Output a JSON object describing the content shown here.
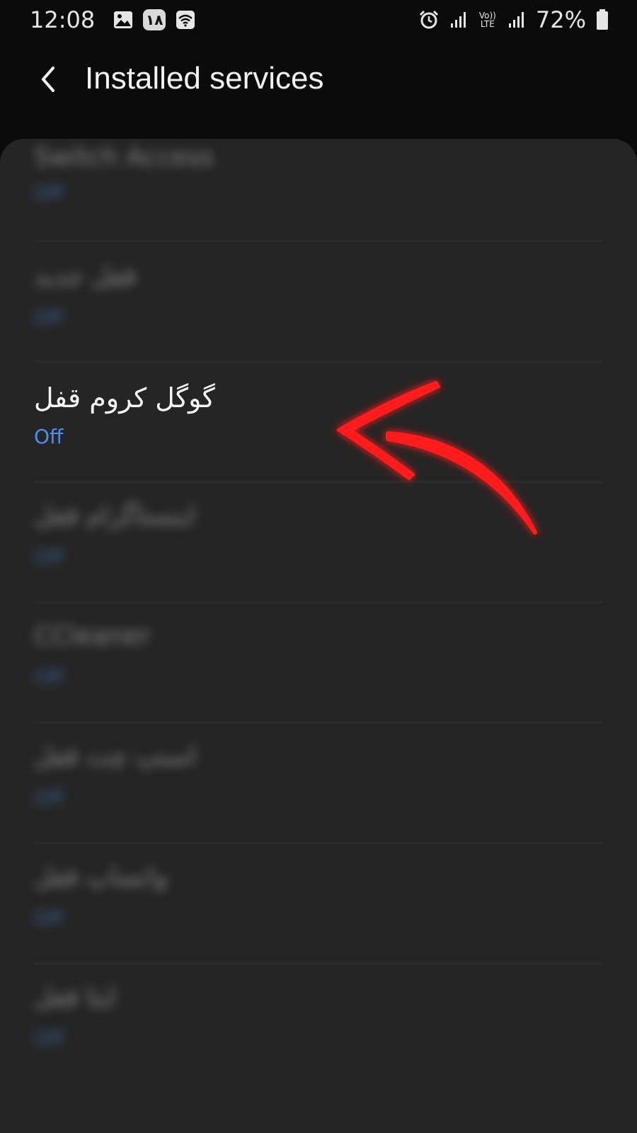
{
  "status_bar": {
    "time": "12:08",
    "badge": "١٨",
    "volte_top": "Vo))",
    "volte_bottom": "LTE",
    "battery": "72%",
    "icons": [
      "image-icon",
      "calendar-badge-icon",
      "wifi-icon",
      "alarm-icon",
      "signal-icon",
      "volte-icon",
      "signal-icon",
      "battery-icon"
    ]
  },
  "header": {
    "title": "Installed services",
    "back_icon": "chevron-left-icon"
  },
  "list": {
    "items": [
      {
        "title": "Switch Access",
        "status": "Off",
        "blurred": true
      },
      {
        "title": "قفل جدید",
        "status": "Off",
        "blurred": true
      },
      {
        "title": "گوگل کروم قفل",
        "status": "Off",
        "blurred": false
      },
      {
        "title": "اینستاگرام قفل",
        "status": "Off",
        "blurred": true
      },
      {
        "title": "CCleaner",
        "status": "Off",
        "blurred": true
      },
      {
        "title": "اسنپ چت قفل",
        "status": "Off",
        "blurred": true
      },
      {
        "title": "واتساپ قفل",
        "status": "Off",
        "blurred": true
      },
      {
        "title": "ایتا قفل",
        "status": "Off",
        "blurred": true
      }
    ]
  },
  "colors": {
    "background": "#0b0b0b",
    "card": "#252525",
    "accent": "#4c8ff0",
    "arrow": "#ff1a1a"
  }
}
